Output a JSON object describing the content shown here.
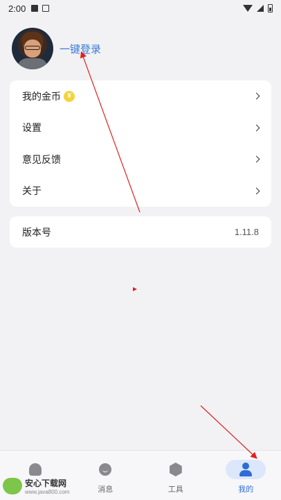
{
  "status_bar": {
    "time": "2:00",
    "icons": [
      "notification-a-icon",
      "notification-card-icon",
      "wifi-icon",
      "signal-icon",
      "battery-charging-icon"
    ]
  },
  "profile": {
    "avatar_icon": "cartoon-boy-avatar",
    "login_label": "一键登录"
  },
  "menu": {
    "items": [
      {
        "label": "我的金币",
        "badge_icon": "coin-icon",
        "badge_glyph": "¥"
      },
      {
        "label": "设置"
      },
      {
        "label": "意见反馈"
      },
      {
        "label": "关于"
      }
    ]
  },
  "version": {
    "label": "版本号",
    "value": "1.11.8"
  },
  "tab_bar": {
    "tabs": [
      {
        "label": "",
        "icon": "home-icon",
        "active": false
      },
      {
        "label": "消息",
        "icon": "message-icon",
        "active": false
      },
      {
        "label": "工具",
        "icon": "tool-icon",
        "active": false
      },
      {
        "label": "我的",
        "icon": "user-icon",
        "active": true
      }
    ]
  },
  "watermark": {
    "title": "安心下载网",
    "url": "www.java800.com",
    "logo_text": "免费"
  },
  "colors": {
    "accent": "#2e6cd6",
    "link": "#3b7bd8",
    "background": "#f2f2f4",
    "annotation_arrow": "#e02020"
  }
}
